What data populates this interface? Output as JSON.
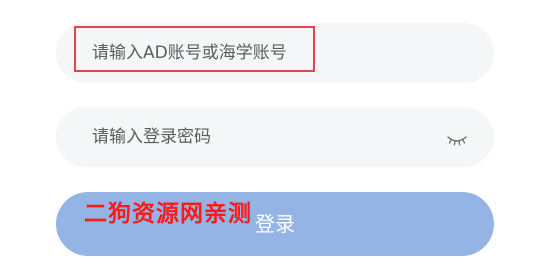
{
  "form": {
    "account_placeholder": "请输入AD账号或海学账号",
    "password_placeholder": "请输入登录密码",
    "password_toggle_icon": "eye-closed-icon",
    "login_label": "登录"
  },
  "overlay": {
    "watermark": "二狗资源网亲测",
    "highlight_color": "#e0474b"
  },
  "colors": {
    "field_background": "#f5f6f8",
    "button_background": "#93b4e4",
    "watermark": "#ff1a1a"
  }
}
